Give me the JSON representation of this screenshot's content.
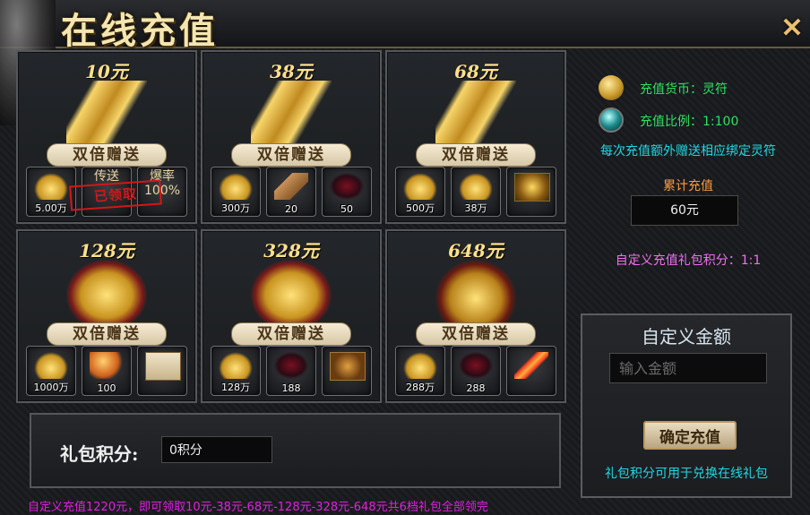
{
  "window": {
    "title": "在线充值",
    "close_icon": "close-icon",
    "close_glyph": "✕"
  },
  "packages": [
    {
      "price": "10元",
      "banner": "双倍赠送",
      "items": [
        {
          "icon": "gold-ingot-icon",
          "qty": "5.00万"
        },
        {
          "icon": "text-slot",
          "text": "传送"
        },
        {
          "icon": "text-slot",
          "text": "爆率\n100%"
        }
      ],
      "claimed": "已领取"
    },
    {
      "price": "38元",
      "banner": "双倍赠送",
      "items": [
        {
          "icon": "gold-ingot-icon",
          "qty": "300万"
        },
        {
          "icon": "scroll-icon",
          "qty": "20"
        },
        {
          "icon": "dark-armor-icon",
          "qty": "50"
        }
      ]
    },
    {
      "price": "68元",
      "banner": "双倍赠送",
      "items": [
        {
          "icon": "gold-ingot-icon",
          "qty": "500万"
        },
        {
          "icon": "gold-ingot-icon",
          "qty": "38万"
        },
        {
          "icon": "treasure-icon",
          "qty": ""
        }
      ]
    },
    {
      "price": "128元",
      "banner": "双倍赠送",
      "items": [
        {
          "icon": "gold-ingot-icon",
          "qty": "1000万"
        },
        {
          "icon": "orange-orb-icon",
          "qty": "100"
        },
        {
          "icon": "scroll-art-icon",
          "qty": ""
        }
      ]
    },
    {
      "price": "328元",
      "banner": "双倍赠送",
      "items": [
        {
          "icon": "gold-ingot-icon",
          "qty": "128万"
        },
        {
          "icon": "dark-armor-icon",
          "qty": "188"
        },
        {
          "icon": "dragon-emblem-icon",
          "qty": ""
        }
      ]
    },
    {
      "price": "648元",
      "banner": "双倍赠送",
      "items": [
        {
          "icon": "gold-ingot-icon",
          "qty": "288万"
        },
        {
          "icon": "dark-armor-icon",
          "qty": "288"
        },
        {
          "icon": "flame-sword-icon",
          "qty": ""
        }
      ]
    }
  ],
  "gift_points": {
    "label": "礼包积分:",
    "value": "0积分"
  },
  "sidebar": {
    "currency": "充值货币：灵符",
    "ratio": "充值比例：1:100",
    "bonus_note": "每次充值额外赠送相应绑定灵符",
    "total_label": "累计充值",
    "total_value": "60元",
    "custom_points": "自定义充值礼包积分：1:1",
    "custom_header": "自定义金额",
    "amount_placeholder": "输入金额",
    "confirm_label": "确定充值",
    "exchange_tip": "礼包积分可用于兑换在线礼包"
  },
  "footer_note": "自定义充值1220元，即可领取10元-38元-68元-128元-328元-648元共6档礼包全部领完",
  "colors": {
    "green": "#30e060",
    "orange": "#ff9a40",
    "pink": "#f070f0",
    "cyan": "#20d8e0",
    "magenta": "#e020e0",
    "gold": "#ffe08a"
  }
}
